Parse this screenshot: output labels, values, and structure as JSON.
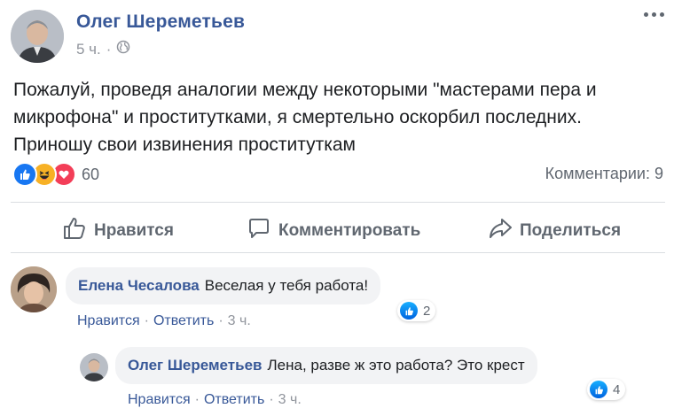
{
  "post": {
    "author": "Олег Шереметьев",
    "time": "5 ч.",
    "separator": "·",
    "text": "Пожалуй, проведя аналогии между некоторыми \"мастерами пера и микрофона\" и проститутками, я смертельно оскорбил последних. Приношу свои извинения проституткам",
    "reactions_count": "60",
    "comments_count": "Комментарии: 9",
    "reaction_icons": [
      "like-icon",
      "haha-icon",
      "love-icon"
    ]
  },
  "actions": {
    "like": "Нравится",
    "comment": "Комментировать",
    "share": "Поделиться"
  },
  "comments": [
    {
      "author": "Елена Чесалова",
      "text": "Веселая у тебя работа!",
      "like": "Нравится",
      "dot": "·",
      "reply": "Ответить",
      "time": "3 ч.",
      "likes": "2"
    },
    {
      "author": "Олег Шереметьев",
      "text": "Лена, разве ж это работа? Это крест",
      "like": "Нравится",
      "dot": "·",
      "reply": "Ответить",
      "time": "3 ч.",
      "likes": "4"
    }
  ],
  "colors": {
    "link": "#385898",
    "muted": "#90949c",
    "like_blue": "#1877f2",
    "love_red": "#f33e58",
    "haha_yellow": "#f7b125"
  }
}
